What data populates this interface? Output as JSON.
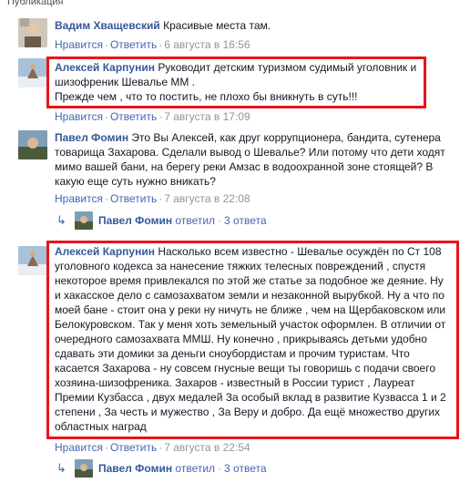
{
  "top": {
    "cut_label": "Публикация"
  },
  "ui": {
    "like_label": "Нравится",
    "reply_label": "Ответить",
    "sep": "·"
  },
  "comments": [
    {
      "author": "Вадим Хващевский",
      "text": "Красивые места там.",
      "date": "6 августа в 16:56"
    },
    {
      "author": "Алексей Карпунин",
      "text_lines": [
        "Руководит детским туризмом судимый уголовник и",
        "шизофреник Шевалье ММ .",
        "Прежде чем , что то постить, не плохо бы вникнуть в суть!!!"
      ],
      "date": "7 августа в 17:09"
    },
    {
      "author": "Павел Фомин",
      "text_lines": [
        "Это Вы Алексей, как друг коррупционера, бандита, сутенера",
        "товарища Захарова. Сделали вывод о Шевалье? Или потому что дети ходят",
        "мимо вашей бани, на берегу реки Амзас в водоохранной зоне стоящей? В",
        "какую еще суть нужно вникать?"
      ],
      "date": "7 августа в 22:08",
      "replies": {
        "author": "Павел Фомин",
        "action": "ответил",
        "count": "3 ответа"
      }
    },
    {
      "author": "Алексей Карпунин",
      "text_lines": [
        "Насколько всем известно - Шевалье осуждён по Ст 108",
        "уголовного кодекса за нанесение тяжких телесных повреждений , спустя",
        "некоторое время привлекался по этой же статье за подобное же деяние. Ну",
        "и хакасское дело с самозахватом земли и незаконной вырубкой. Ну а что по",
        "моей бане - стоит она у реки ну ничуть не ближе , чем на Щербаковском или",
        "Белокуровском. Так у меня хоть земельный участок оформлен. В отличии от",
        "очередного самозахвата ММШ. Ну конечно , прикрываясь детьми удобно",
        "сдавать эти домики за деньги сноубордистам и прочим туристам. Что",
        "касается Захарова - ну совсем гнусные вещи ты говоришь с подачи своего",
        "хозяина-шизофреника. Захаров - известный в России турист , Лауреат",
        "Премии Кузбасса , двух медалей За особый вклад в развитие Кузвасса 1 и 2",
        "степени , За честь и мужество , За Веру и добро. Да ещё множество других",
        "областных наград"
      ],
      "date": "7 августа в 22:54",
      "replies": {
        "author": "Павел Фомин",
        "action": "ответил",
        "count": "3 ответа"
      }
    }
  ],
  "colors": {
    "link": "#365899",
    "highlight": "#e8141b",
    "meta": "#90949c"
  },
  "icons": [
    "reply-arrow-icon"
  ]
}
